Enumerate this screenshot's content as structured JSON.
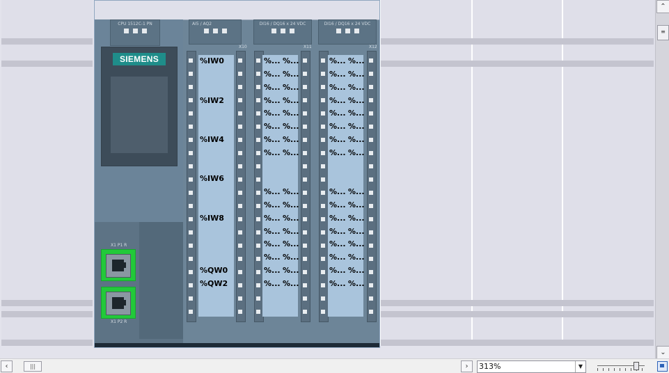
{
  "device": {
    "cpu_label": "CPU 1512C-1 PN",
    "ai_module_label": "AI5 / AQ2",
    "di_module_1_label": "DI16 / DQ16 x 24 VDC",
    "di_module_2_label": "DI16 / DQ16 x 24 VDC",
    "brand": "SIEMENS",
    "port_label_top": "X1 P1 R",
    "port_label_bottom": "X1 P2 R",
    "connector_labels": {
      "x10": "X10",
      "x11": "X11",
      "x12": "X12"
    },
    "analog_addresses": [
      "%IW0",
      "%IW2",
      "%IW4",
      "%IW6",
      "%IW8",
      "%QW0",
      "%QW2"
    ],
    "truncated_address": "%..."
  },
  "view": {
    "zoom": "313%",
    "zoom_options_icon": "chevron-down-icon"
  },
  "icons": {
    "scroll_up": "chevron-up-icon",
    "scroll_down": "chevron-down-icon",
    "scroll_left": "chevron-left-icon",
    "scroll_right": "chevron-right-icon",
    "fit": "zoom-fit-icon"
  },
  "colors": {
    "brand": "#1f8d8a",
    "port_active": "#22c93a",
    "address_field": "#a9c4dc"
  }
}
